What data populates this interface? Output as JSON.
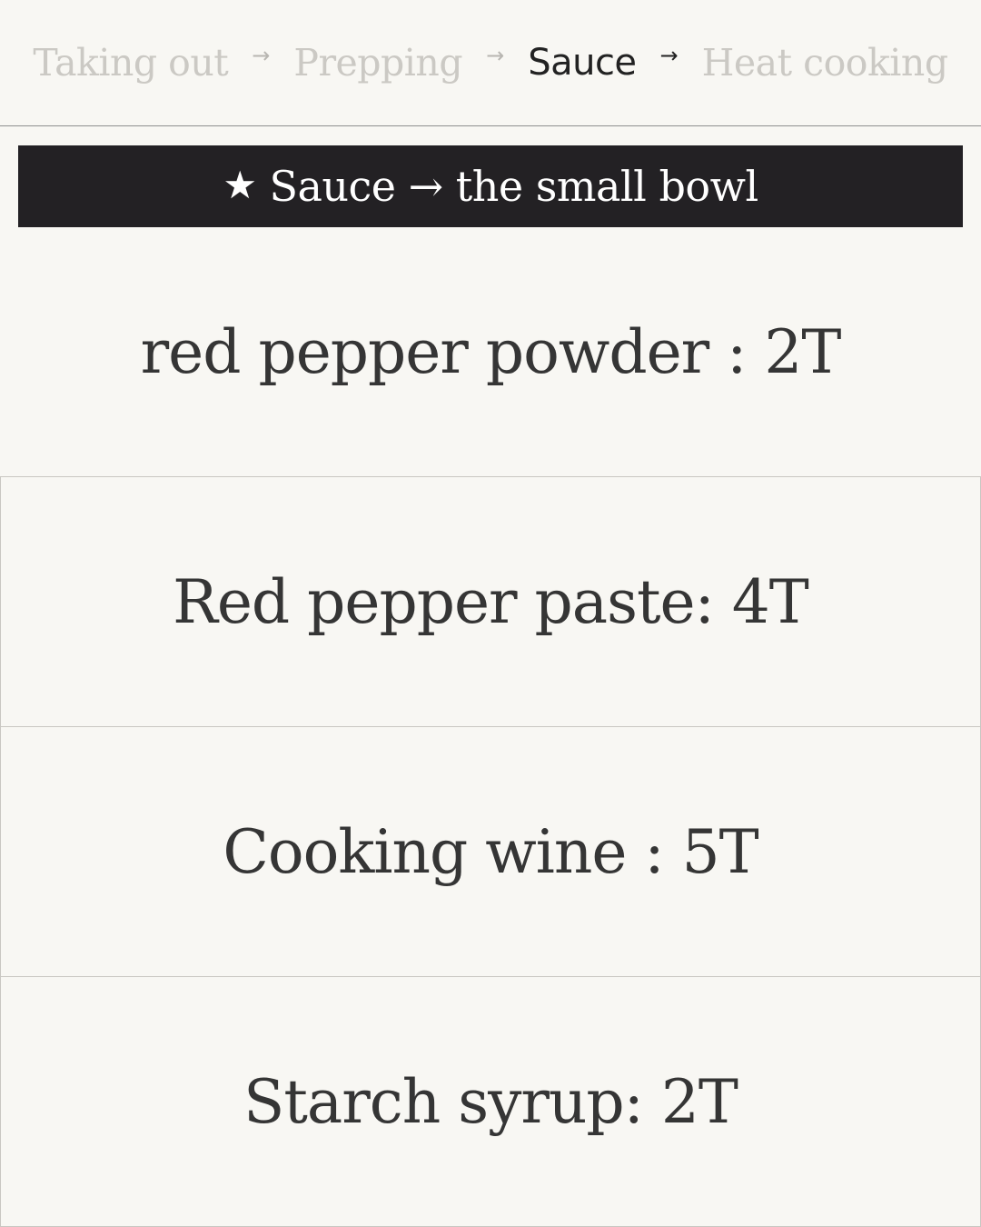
{
  "steps": [
    {
      "label": "Taking out",
      "state": "inactive"
    },
    {
      "label": "Prepping",
      "state": "inactive"
    },
    {
      "label": "Sauce",
      "state": "active"
    },
    {
      "label": "Heat cooking",
      "state": "inactive"
    }
  ],
  "step_arrow": "→",
  "banner": {
    "icon": "star-icon",
    "star_glyph": "★",
    "text": "Sauce → the small bowl"
  },
  "ingredients": [
    "red pepper powder : 2T",
    "Red pepper paste: 4T",
    "Cooking wine : 5T",
    "Starch syrup: 2T"
  ],
  "colors": {
    "background": "#f8f7f3",
    "banner_background": "#232124",
    "active_step": "#222222",
    "inactive_step": "#cbc9c4",
    "text": "#353535"
  }
}
